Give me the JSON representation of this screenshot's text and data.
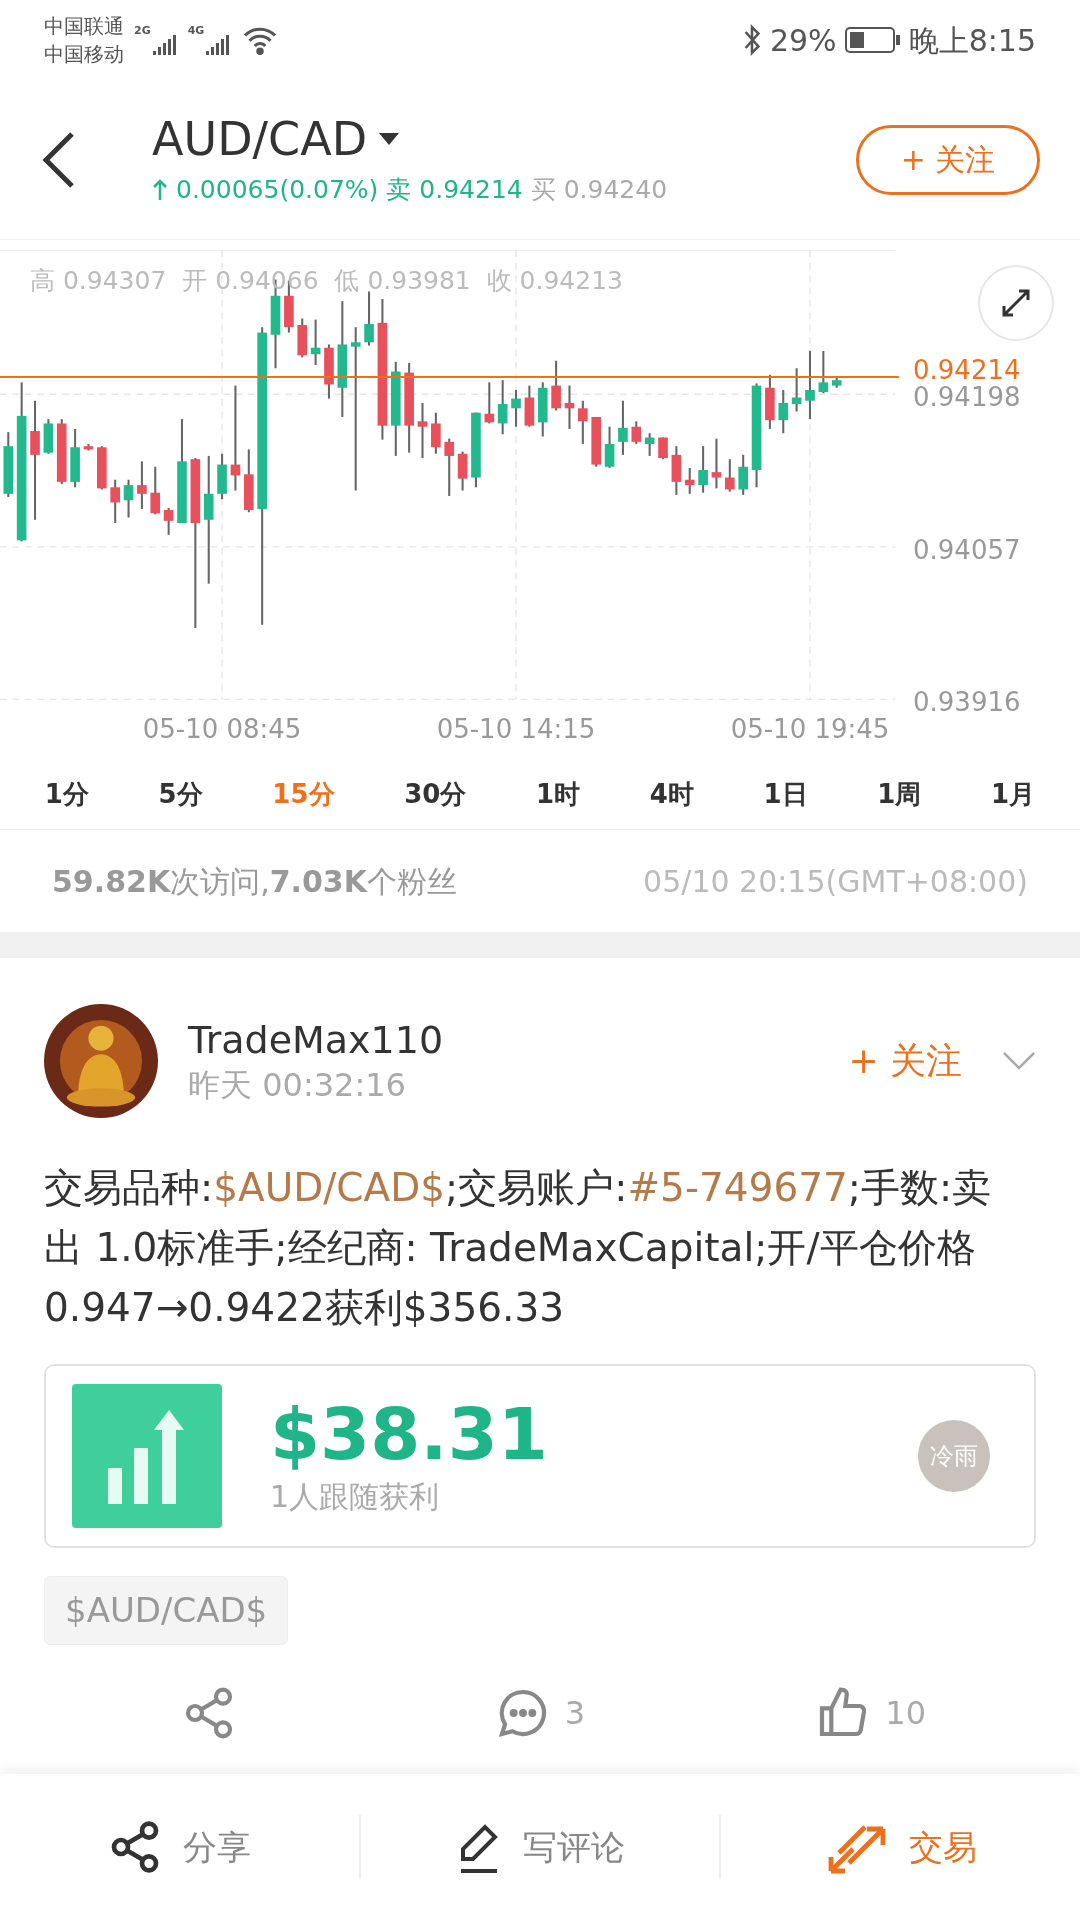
{
  "status_bar": {
    "carriers": [
      "中国联通",
      "中国移动"
    ],
    "signal_labels": [
      "2G",
      "4G"
    ],
    "battery": "29%",
    "time": "晚上8:15"
  },
  "header": {
    "symbol": "AUD/CAD",
    "change": "0.00065(0.07%)",
    "sell_label": "卖",
    "sell": "0.94214",
    "buy_label": "买",
    "buy": "0.94240",
    "follow": "+ 关注"
  },
  "chart": {
    "ohlc_summary": "高 0.94307  开 0.94066  低 0.93981  收 0.94213",
    "chart_data": {
      "type": "candlestick",
      "ylim": [
        0.93916,
        0.94331
      ],
      "grid": true,
      "ref_lines": [
        {
          "axis": "y",
          "value": 0.94214,
          "label": "0.94214",
          "color": "#ee6f1c"
        }
      ],
      "yticks": [
        {
          "value": 0.94198,
          "label": "0.94198"
        },
        {
          "value": 0.94057,
          "label": "0.94057"
        },
        {
          "value": 0.93916,
          "label": "0.93916"
        }
      ],
      "categories": [
        null,
        null,
        null,
        null,
        null,
        null,
        null,
        null,
        null,
        null,
        null,
        null,
        null,
        null,
        null,
        null,
        "05-10 08:45",
        null,
        null,
        null,
        null,
        null,
        null,
        null,
        null,
        null,
        null,
        null,
        null,
        null,
        null,
        null,
        null,
        null,
        null,
        null,
        null,
        null,
        "05-10 14:15",
        null,
        null,
        null,
        null,
        null,
        null,
        null,
        null,
        null,
        null,
        null,
        null,
        null,
        null,
        null,
        null,
        null,
        null,
        null,
        null,
        null,
        "05-10 19:45",
        null,
        null
      ],
      "ohlc": [
        [
          0.94106,
          0.94163,
          0.94103,
          0.9415
        ],
        [
          0.94063,
          0.94209,
          0.94062,
          0.94178
        ],
        [
          0.94164,
          0.94192,
          0.94082,
          0.94142
        ],
        [
          0.94144,
          0.94175,
          0.94143,
          0.94171
        ],
        [
          0.94171,
          0.94175,
          0.94115,
          0.94117
        ],
        [
          0.94117,
          0.94166,
          0.94112,
          0.94149
        ],
        [
          0.9415,
          0.94152,
          0.94146,
          0.94147
        ],
        [
          0.94149,
          0.9415,
          0.9411,
          0.94111
        ],
        [
          0.94112,
          0.94119,
          0.94079,
          0.94098
        ],
        [
          0.941,
          0.94119,
          0.94084,
          0.94114
        ],
        [
          0.94114,
          0.94136,
          0.94092,
          0.94106
        ],
        [
          0.94107,
          0.94131,
          0.94087,
          0.94088
        ],
        [
          0.94091,
          0.94093,
          0.94068,
          0.94081
        ],
        [
          0.94079,
          0.94175,
          0.94079,
          0.94136
        ],
        [
          0.94138,
          0.94139,
          0.93982,
          0.94079
        ],
        [
          0.94082,
          0.94141,
          0.94023,
          0.94106
        ],
        [
          0.94106,
          0.94143,
          0.94101,
          0.94133
        ],
        [
          0.94133,
          0.94206,
          0.94109,
          0.94123
        ],
        [
          0.94124,
          0.94147,
          0.94089,
          0.94091
        ],
        [
          0.94092,
          0.9426,
          0.93985,
          0.94255
        ],
        [
          0.94253,
          0.94304,
          0.94222,
          0.94289
        ],
        [
          0.94289,
          0.94303,
          0.94255,
          0.9426
        ],
        [
          0.94262,
          0.94268,
          0.94232,
          0.94234
        ],
        [
          0.94235,
          0.94267,
          0.94225,
          0.94241
        ],
        [
          0.94241,
          0.94244,
          0.94194,
          0.94207
        ],
        [
          0.94204,
          0.94284,
          0.94177,
          0.94244
        ],
        [
          0.94242,
          0.9426,
          0.94109,
          0.94246
        ],
        [
          0.94246,
          0.94293,
          0.94243,
          0.94263
        ],
        [
          0.94264,
          0.94286,
          0.94156,
          0.94169
        ],
        [
          0.94169,
          0.94228,
          0.94141,
          0.94219
        ],
        [
          0.94218,
          0.94227,
          0.94144,
          0.94169
        ],
        [
          0.94173,
          0.9419,
          0.94139,
          0.94168
        ],
        [
          0.94171,
          0.94181,
          0.94143,
          0.94149
        ],
        [
          0.94154,
          0.94157,
          0.94104,
          0.94141
        ],
        [
          0.94143,
          0.94145,
          0.94109,
          0.9412
        ],
        [
          0.94121,
          0.94181,
          0.94112,
          0.94181
        ],
        [
          0.9418,
          0.94209,
          0.94171,
          0.94172
        ],
        [
          0.94171,
          0.94211,
          0.94161,
          0.94189
        ],
        [
          0.94185,
          0.94202,
          0.94168,
          0.94194
        ],
        [
          0.94195,
          0.94206,
          0.94168,
          0.94169
        ],
        [
          0.94172,
          0.94209,
          0.94159,
          0.94204
        ],
        [
          0.94206,
          0.94229,
          0.94183,
          0.94185
        ],
        [
          0.9419,
          0.94206,
          0.94166,
          0.94185
        ],
        [
          0.94185,
          0.94192,
          0.94152,
          0.94173
        ],
        [
          0.94177,
          0.94177,
          0.94131,
          0.94133
        ],
        [
          0.94131,
          0.94168,
          0.9413,
          0.94152
        ],
        [
          0.94154,
          0.94192,
          0.94142,
          0.94167
        ],
        [
          0.94168,
          0.94173,
          0.94152,
          0.94154
        ],
        [
          0.94152,
          0.94162,
          0.94141,
          0.94158
        ],
        [
          0.94158,
          0.94158,
          0.94138,
          0.94139
        ],
        [
          0.94142,
          0.9415,
          0.94105,
          0.94117
        ],
        [
          0.94119,
          0.9413,
          0.94106,
          0.94114
        ],
        [
          0.94114,
          0.9415,
          0.94107,
          0.94128
        ],
        [
          0.94126,
          0.94157,
          0.94111,
          0.94121
        ],
        [
          0.94121,
          0.94138,
          0.94108,
          0.9411
        ],
        [
          0.9411,
          0.94142,
          0.94105,
          0.94131
        ],
        [
          0.94128,
          0.94208,
          0.94112,
          0.94206
        ],
        [
          0.94204,
          0.94216,
          0.94166,
          0.94174
        ],
        [
          0.94174,
          0.94202,
          0.94162,
          0.9419
        ],
        [
          0.94189,
          0.94222,
          0.94182,
          0.94195
        ],
        [
          0.94192,
          0.94238,
          0.94175,
          0.94202
        ],
        [
          0.942,
          0.94238,
          0.94199,
          0.94209
        ],
        [
          0.94206,
          0.94214,
          0.94204,
          0.94211
        ]
      ]
    }
  },
  "timeframes": [
    {
      "label": "1分",
      "selected": false
    },
    {
      "label": "5分",
      "selected": false
    },
    {
      "label": "15分",
      "selected": true
    },
    {
      "label": "30分",
      "selected": false
    },
    {
      "label": "1时",
      "selected": false
    },
    {
      "label": "4时",
      "selected": false
    },
    {
      "label": "1日",
      "selected": false
    },
    {
      "label": "1周",
      "selected": false
    },
    {
      "label": "1月",
      "selected": false
    }
  ],
  "stats": {
    "summary": "**59.82K**次访问,**7.03K**个粉丝",
    "timestamp": "05/10 20:15(GMT+08:00)"
  },
  "post": {
    "author": "TradeMax110",
    "time": "昨天 00:32:16",
    "follow": "+ 关注",
    "body": [
      {
        "kind": "text",
        "text": "交易品种:"
      },
      {
        "kind": "link",
        "text": "$AUD/CAD$"
      },
      {
        "kind": "text",
        "text": ";交易账户:"
      },
      {
        "kind": "link",
        "text": "#5-749677"
      },
      {
        "kind": "text",
        "text": ";手数:卖出 1.0标准手;经纪商: TradeMaxCapital;开/平仓价格0.947→0.9422获利$356.33"
      }
    ],
    "profit": {
      "amount": "$38.31",
      "caption": "1人跟随获利",
      "follower": "冷雨"
    },
    "tag": "$AUD/CAD$",
    "actions": [
      {
        "kind": "share"
      },
      {
        "kind": "comment",
        "count": "3"
      },
      {
        "kind": "like",
        "count": "10"
      }
    ]
  },
  "bottom_nav": [
    {
      "kind": "share",
      "label": "分享",
      "selected": false
    },
    {
      "kind": "write",
      "label": "写评论",
      "selected": false
    },
    {
      "kind": "trade",
      "label": "交易",
      "selected": true
    }
  ]
}
